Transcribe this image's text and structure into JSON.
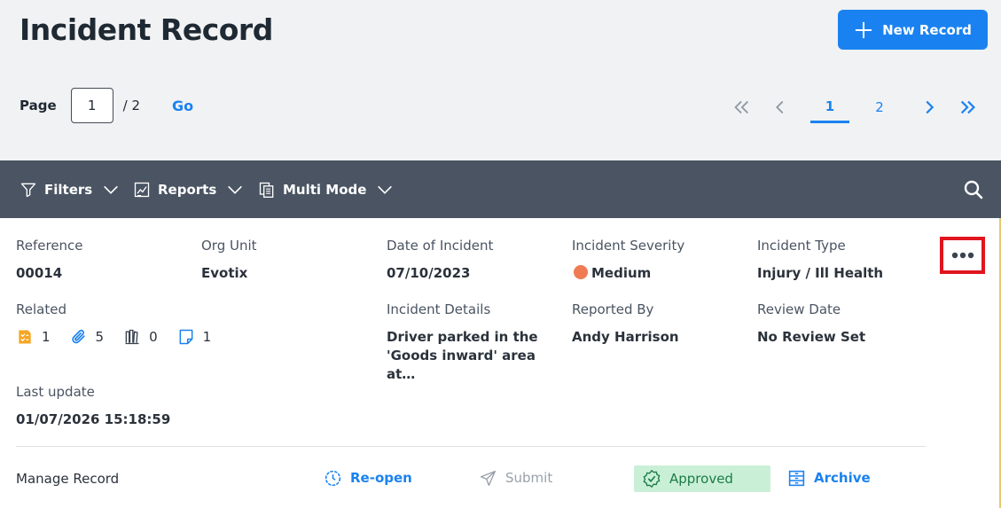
{
  "header": {
    "title": "Incident Record",
    "new_button_label": "New Record"
  },
  "pagination": {
    "page_label": "Page",
    "current_page": "1",
    "total_label": "/ 2",
    "go_label": "Go",
    "pages": [
      "1",
      "2"
    ],
    "active_page": "1"
  },
  "toolbar": {
    "filters_label": "Filters",
    "reports_label": "Reports",
    "multi_mode_label": "Multi Mode"
  },
  "record": {
    "reference": {
      "label": "Reference",
      "value": "00014"
    },
    "org_unit": {
      "label": "Org Unit",
      "value": "Evotix"
    },
    "date_of_incident": {
      "label": "Date of Incident",
      "value": "07/10/2023"
    },
    "incident_severity": {
      "label": "Incident Severity",
      "value": "Medium",
      "color": "#ef7c52"
    },
    "incident_type": {
      "label": "Incident Type",
      "value": "Injury / Ill Health"
    },
    "related": {
      "label": "Related",
      "items": [
        {
          "icon": "task-list-icon",
          "count": "1"
        },
        {
          "icon": "paperclip-icon",
          "count": "5"
        },
        {
          "icon": "books-icon",
          "count": "0"
        },
        {
          "icon": "note-icon",
          "count": "1"
        }
      ]
    },
    "incident_details": {
      "label": "Incident Details",
      "value": "Driver parked in the 'Goods inward' area at…"
    },
    "reported_by": {
      "label": "Reported By",
      "value": "Andy Harrison"
    },
    "review_date": {
      "label": "Review Date",
      "value": "No Review Set"
    },
    "last_update": {
      "label": "Last update",
      "value": "01/07/2026 15:18:59"
    }
  },
  "manage": {
    "label": "Manage Record",
    "reopen_label": "Re-open",
    "submit_label": "Submit",
    "status_label": "Approved",
    "archive_label": "Archive"
  },
  "colors": {
    "accent": "#1a82f0",
    "toolbar_bg": "#4a5462",
    "approved_bg": "#c9f0d6",
    "highlight": "#e0151d"
  }
}
